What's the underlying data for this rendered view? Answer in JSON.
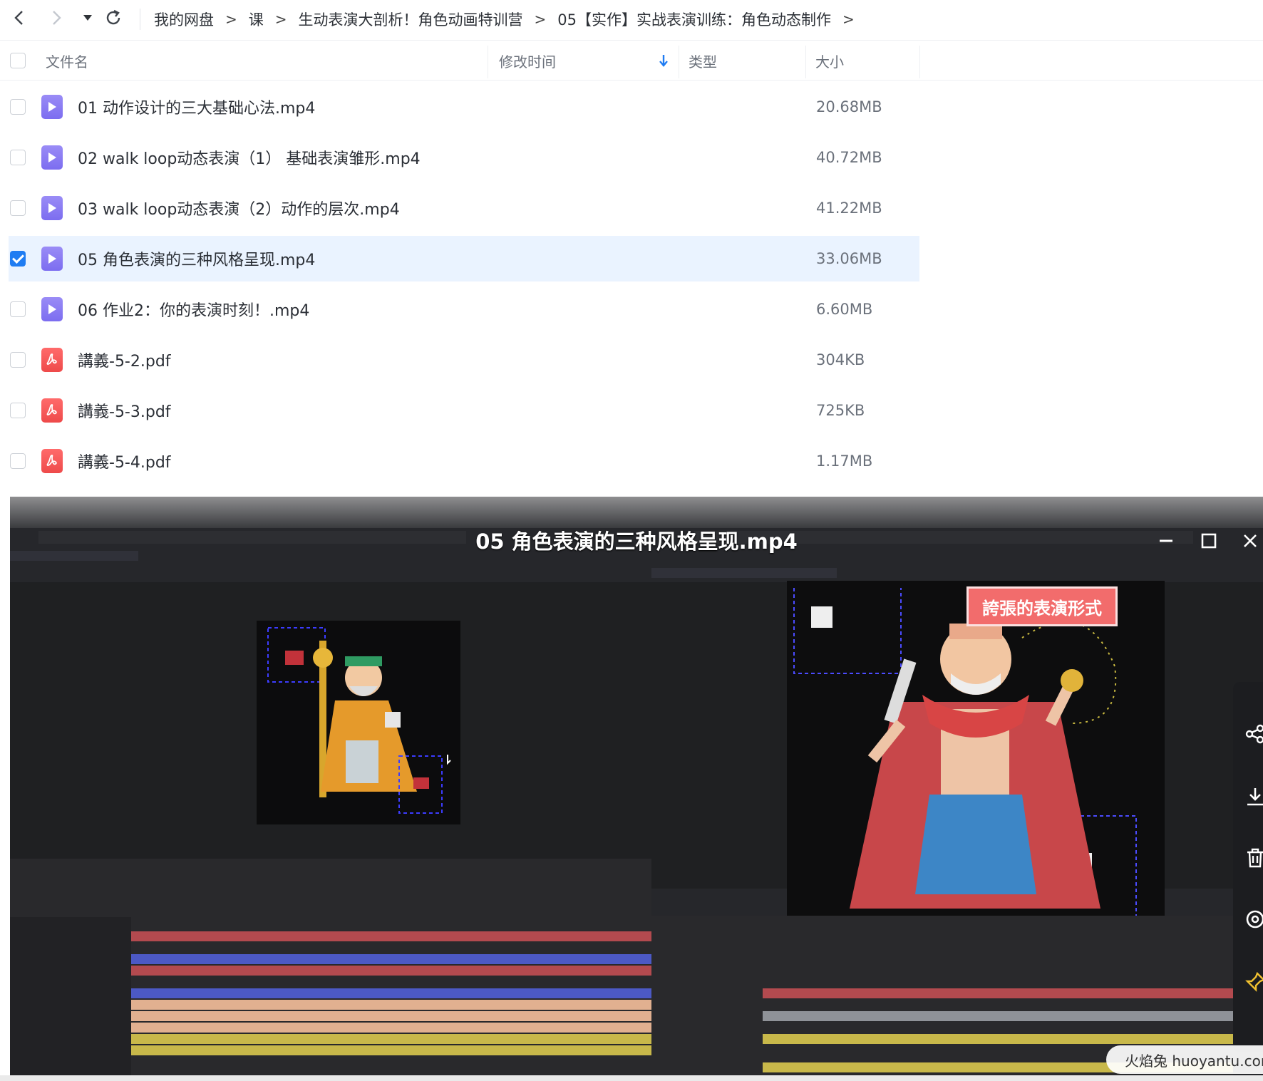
{
  "toolbar": {
    "back_icon": "chevron-left-icon",
    "forward_icon": "chevron-right-icon",
    "history_icon": "caret-down-icon",
    "refresh_icon": "refresh-icon",
    "breadcrumb": [
      "我的网盘",
      "课",
      "生动表演大剖析！角色动画特训营",
      "05【实作】实战表演训练：角色动态制作"
    ],
    "separator": ">"
  },
  "table": {
    "columns": {
      "name": "文件名",
      "modified": "修改时间",
      "type": "类型",
      "size": "大小"
    },
    "sort_icon": "arrow-down-icon",
    "rows": [
      {
        "name": "01 动作设计的三大基础心法.mp4",
        "size": "20.68MB",
        "kind": "video",
        "checked": false
      },
      {
        "name": "02 walk loop动态表演（1） 基础表演雏形.mp4",
        "size": "40.72MB",
        "kind": "video",
        "checked": false
      },
      {
        "name": "03 walk loop动态表演（2）动作的层次.mp4",
        "size": "41.22MB",
        "kind": "video",
        "checked": false
      },
      {
        "name": "05 角色表演的三种风格呈现.mp4",
        "size": "33.06MB",
        "kind": "video",
        "checked": true
      },
      {
        "name": "06 作业2：你的表演时刻！.mp4",
        "size": "6.60MB",
        "kind": "video",
        "checked": false
      },
      {
        "name": "講義-5-2.pdf",
        "size": "304KB",
        "kind": "pdf",
        "checked": false
      },
      {
        "name": "講義-5-3.pdf",
        "size": "725KB",
        "kind": "pdf",
        "checked": false
      },
      {
        "name": "講義-5-4.pdf",
        "size": "1.17MB",
        "kind": "pdf",
        "checked": false
      }
    ]
  },
  "player": {
    "title": "05 角色表演的三种风格呈现.mp4",
    "minimize_icon": "minimize-icon",
    "maximize_icon": "maximize-icon",
    "close_icon": "close-icon",
    "caption": "誇張的表演形式",
    "side_tools": [
      "share-icon",
      "download-icon",
      "delete-icon",
      "more-icon",
      "pin-icon"
    ]
  },
  "watermark": "火焰兔 huoyantu.com",
  "colors": {
    "accent": "#1f7cf2",
    "selected_row": "#eaf3ff",
    "video_icon": "#8b7cf4",
    "pdf_icon": "#f05454",
    "caption_bg": "#f26c6c"
  }
}
